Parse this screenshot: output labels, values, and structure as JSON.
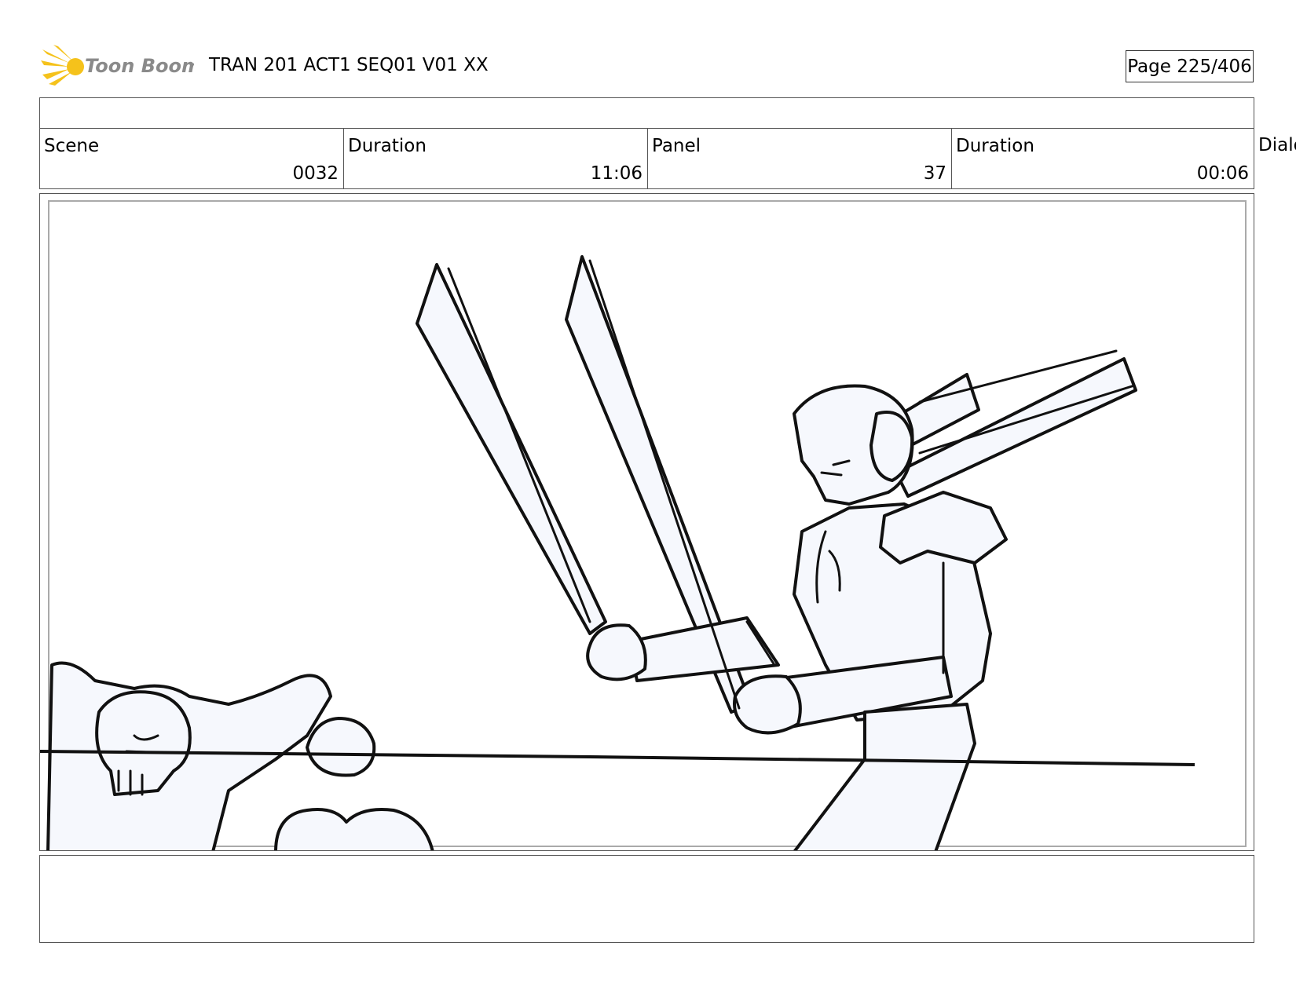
{
  "header": {
    "logo_text": "Toon Boom",
    "title": "TRAN 201 ACT1 SEQ01 V01 XX",
    "page": "Page 225/406"
  },
  "info": {
    "scene_label": "Scene",
    "scene_value": "0032",
    "scene_duration_label": "Duration",
    "scene_duration_value": "11:06",
    "panel_label": "Panel",
    "panel_value": "37",
    "panel_duration_label": "Duration",
    "panel_duration_value": "00:06",
    "dialog_label": "Dialog"
  },
  "panel": {
    "image_name": "storyboard-sketch",
    "fill_color": "#f6f8fd",
    "line_color": "#111111"
  },
  "colors": {
    "logo_yellow": "#f5c21b",
    "logo_text": "#8a8a8a"
  }
}
